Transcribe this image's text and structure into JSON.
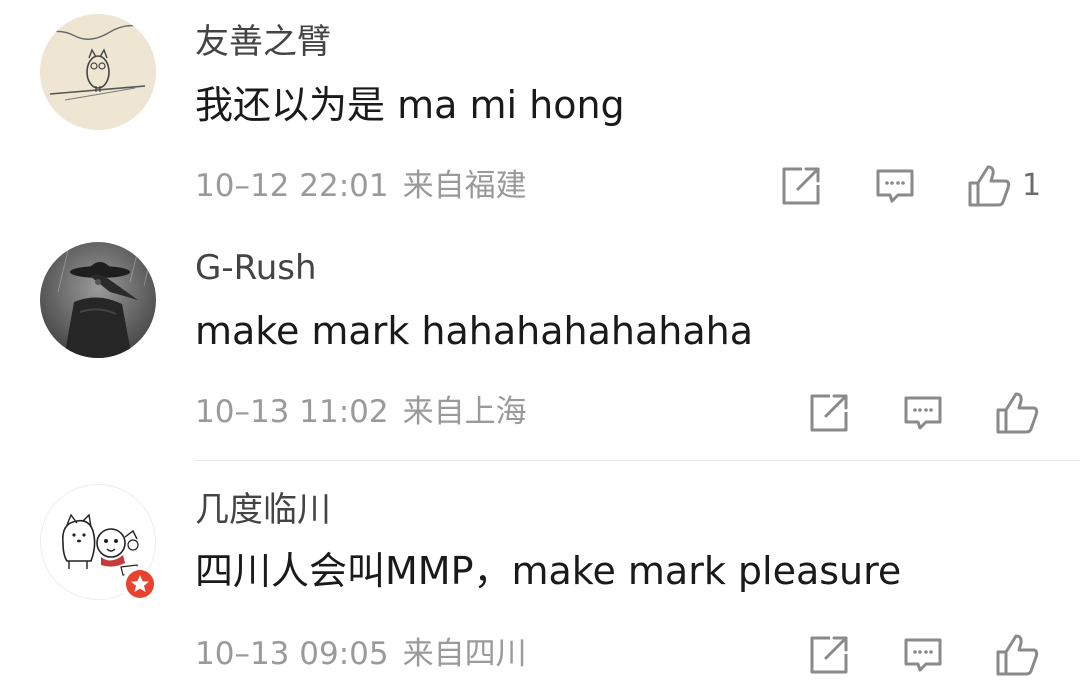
{
  "comments": [
    {
      "username": "友善之臂",
      "content": "我还以为是 ma mi hong",
      "time": "10–12 22:01",
      "location": "来自福建",
      "likes": "1",
      "avatar": "owl-sketch-avatar"
    },
    {
      "username": "G-Rush",
      "content": "make mark hahahahahahaha",
      "time": "10–13 11:02",
      "location": "来自上海",
      "likes": "",
      "avatar": "plague-doctor-avatar"
    },
    {
      "username": "几度临川",
      "content": "四川人会叫MMP，make mark pleasure",
      "time": "10–13 09:05",
      "location": "来自四川",
      "likes": "",
      "avatar": "cartoon-dog-avatar",
      "badge": "red-star-badge"
    }
  ],
  "icons": {
    "share": "share-icon",
    "comment": "comment-icon",
    "like": "like-icon"
  },
  "colors": {
    "text": "#1a1a1a",
    "username": "#444444",
    "meta": "#9a9a9a",
    "icon": "#8a8a8a",
    "badge": "#e8432f"
  }
}
